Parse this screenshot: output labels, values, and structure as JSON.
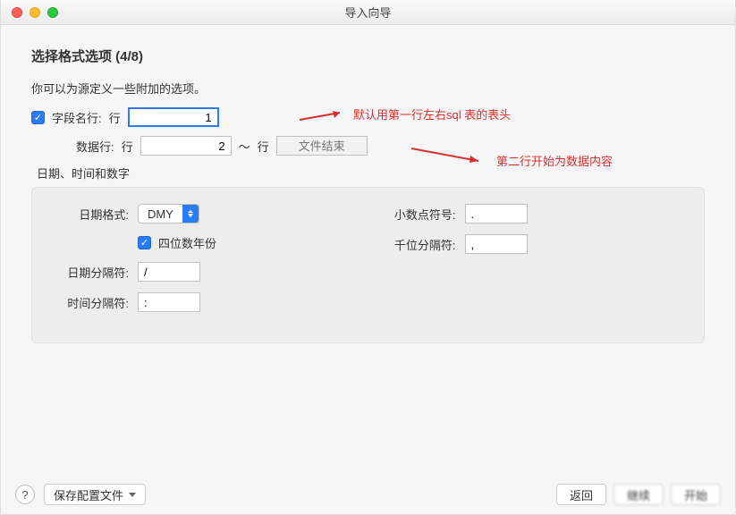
{
  "window": {
    "title": "导入向导"
  },
  "header": {
    "title": "选择格式选项 (4/8)",
    "description": "你可以为源定义一些附加的选项。"
  },
  "fieldNameRow": {
    "checkbox_checked": true,
    "label": "字段名行:",
    "row_label": "行",
    "value": "1"
  },
  "dataRow": {
    "label": "数据行:",
    "row_label": "行",
    "start_value": "2",
    "tilde": "～",
    "end_row_label": "行",
    "end_placeholder": "文件结束"
  },
  "sectionTitle": "日期、时间和数字",
  "dateFormat": {
    "label": "日期格式:",
    "value": "DMY",
    "fourDigitYear_checked": true,
    "fourDigitYear_label": "四位数年份"
  },
  "dateSep": {
    "label": "日期分隔符:",
    "value": "/"
  },
  "timeSep": {
    "label": "时间分隔符:",
    "value": ":"
  },
  "decimalSym": {
    "label": "小数点符号:",
    "value": "."
  },
  "thousandSep": {
    "label": "千位分隔符:",
    "value": ","
  },
  "annotations": {
    "a1": "默认用第一行左右sql 表的表头",
    "a2": "第二行开始为数据内容"
  },
  "footer": {
    "help": "?",
    "saveConfig": "保存配置文件",
    "back": "返回",
    "continue": "继续",
    "start": "开始"
  }
}
